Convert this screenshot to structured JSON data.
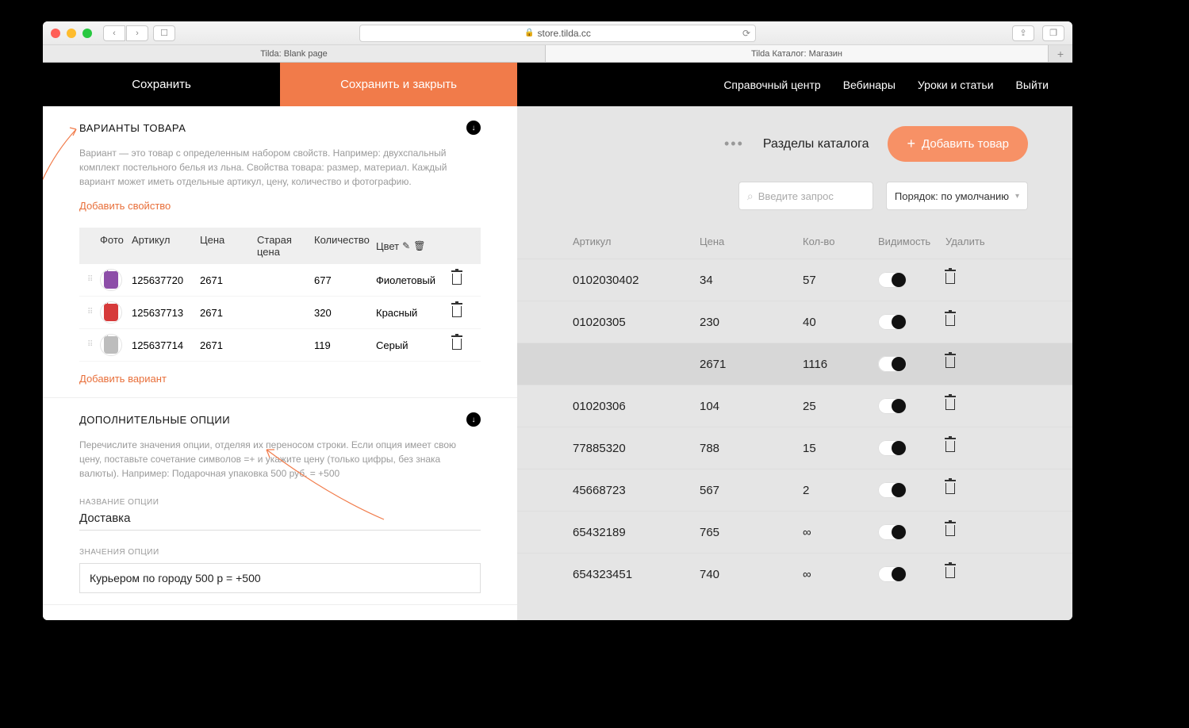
{
  "browser": {
    "url": "store.tilda.cc",
    "tabs": [
      "Tilda: Blank page",
      "Tilda Каталог: Магазин"
    ]
  },
  "left": {
    "save": "Сохранить",
    "save_close": "Сохранить и закрыть",
    "section_variants_title": "ВАРИАНТЫ ТОВАРА",
    "section_variants_desc": "Вариант — это товар с определенным набором свойств. Например: двухспальный комплект постельного белья из льна. Свойства товара: размер, материал. Каждый вариант может иметь отдельные артикул, цену, количество и фотографию.",
    "add_property": "Добавить свойство",
    "headers": {
      "photo": "Фото",
      "sku": "Артикул",
      "price": "Цена",
      "old_price": "Старая цена",
      "qty": "Количество",
      "color": "Цвет"
    },
    "variants": [
      {
        "sku": "125637720",
        "price": "2671",
        "old": "",
        "qty": "677",
        "color": "Фиолетовый",
        "bag": "#8d4ea8"
      },
      {
        "sku": "125637713",
        "price": "2671",
        "old": "",
        "qty": "320",
        "color": "Красный",
        "bag": "#d63a3a"
      },
      {
        "sku": "125637714",
        "price": "2671",
        "old": "",
        "qty": "119",
        "color": "Серый",
        "bag": "#bdbdbd"
      }
    ],
    "add_variant": "Добавить вариант",
    "section_options_title": "ДОПОЛНИТЕЛЬНЫЕ ОПЦИИ",
    "section_options_desc": "Перечислите значения опции, отделяя их переносом строки. Если опция имеет свою цену, поставьте сочетание символов =+ и укажите цену (только цифры, без знака валюты). Например: Подарочная упаковка 500 руб. = +500",
    "option_name_label": "НАЗВАНИЕ ОПЦИИ",
    "option_name_value": "Доставка",
    "option_values_label": "ЗНАЧЕНИЯ ОПЦИИ",
    "option_values_value": "Курьером по городу 500 р = +500"
  },
  "right": {
    "nav": [
      "Справочный центр",
      "Вебинары",
      "Уроки и статьи",
      "Выйти"
    ],
    "sections_label": "Разделы каталога",
    "add_product": "Добавить товар",
    "search_placeholder": "Введите запрос",
    "order_label": "Порядок: по умолчанию",
    "columns": {
      "sku": "Артикул",
      "price": "Цена",
      "qty": "Кол-во",
      "vis": "Видимость",
      "del": "Удалить"
    },
    "rows": [
      {
        "sku": "0102030402",
        "price": "34",
        "qty": "57",
        "on": true,
        "sel": false
      },
      {
        "sku": "01020305",
        "price": "230",
        "qty": "40",
        "on": true,
        "sel": false
      },
      {
        "sku": "",
        "price": "2671",
        "qty": "1116",
        "on": true,
        "sel": true
      },
      {
        "sku": "01020306",
        "price": "104",
        "qty": "25",
        "on": true,
        "sel": false
      },
      {
        "sku": "77885320",
        "price": "788",
        "qty": "15",
        "on": true,
        "sel": false
      },
      {
        "sku": "45668723",
        "price": "567",
        "qty": "2",
        "on": true,
        "sel": false
      },
      {
        "sku": "65432189",
        "price": "765",
        "qty": "∞",
        "on": true,
        "sel": false
      },
      {
        "sku": "654323451",
        "price": "740",
        "qty": "∞",
        "on": true,
        "sel": false
      }
    ]
  }
}
